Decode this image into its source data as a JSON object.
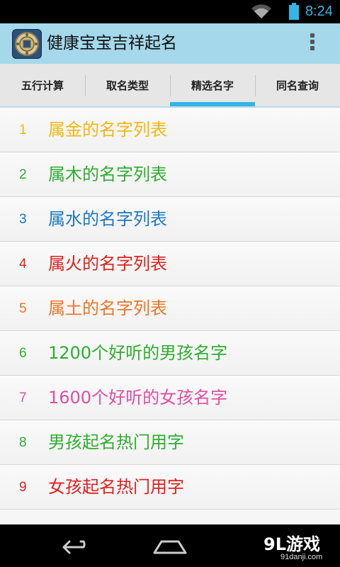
{
  "status_bar": {
    "time": "8:24",
    "wifi_icon": "wifi-icon",
    "battery_icon": "battery-icon",
    "time_color": "#33b5e5"
  },
  "action_bar": {
    "title": "健康宝宝吉祥起名",
    "app_icon": "coin-logo-icon",
    "overflow_icon": "overflow-menu-icon",
    "background": "#a4d8ea"
  },
  "tabs": [
    {
      "label": "五行计算",
      "selected": false
    },
    {
      "label": "取名类型",
      "selected": false
    },
    {
      "label": "精选名字",
      "selected": true
    },
    {
      "label": "同名查询",
      "selected": false
    }
  ],
  "tab_indicator_color": "#33b5e5",
  "list": [
    {
      "num": "1",
      "label": "属金的名字列表",
      "color": "#f5b70f"
    },
    {
      "num": "2",
      "label": "属木的名字列表",
      "color": "#2fae2f"
    },
    {
      "num": "3",
      "label": "属水的名字列表",
      "color": "#1c78c4"
    },
    {
      "num": "4",
      "label": "属火的名字列表",
      "color": "#e0201e"
    },
    {
      "num": "5",
      "label": "属土的名字列表",
      "color": "#ec7626"
    },
    {
      "num": "6",
      "label": "1200个好听的男孩名字",
      "color": "#2fae2f"
    },
    {
      "num": "7",
      "label": "1600个好听的女孩名字",
      "color": "#e04fa3"
    },
    {
      "num": "8",
      "label": "男孩起名热门用字",
      "color": "#2fae2f"
    },
    {
      "num": "9",
      "label": "女孩起名热门用字",
      "color": "#e0201e"
    }
  ],
  "nav_bar": {
    "back_icon": "back-arrow-icon",
    "home_icon": "home-icon"
  },
  "watermark": {
    "brand": "9L游戏",
    "url": "91danji.com"
  }
}
